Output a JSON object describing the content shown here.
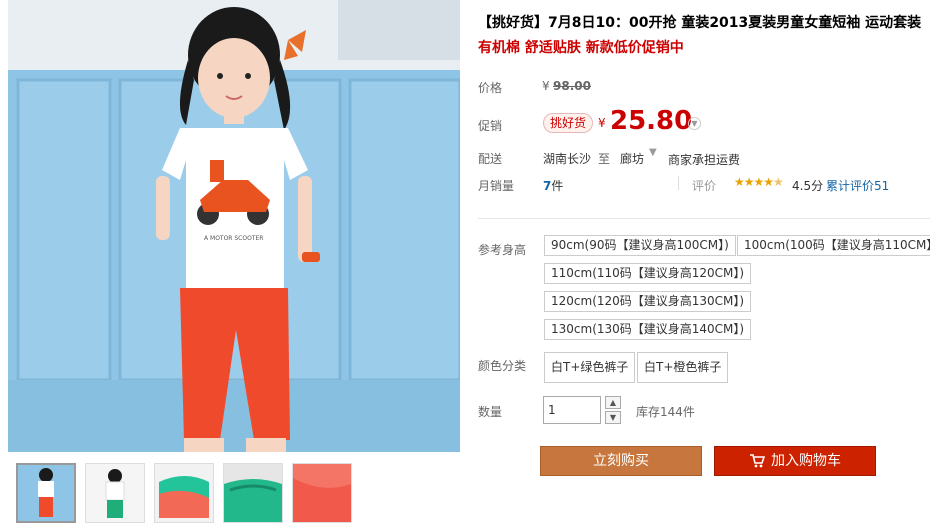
{
  "product": {
    "title": "【挑好货】7月8日10：00开抢 童装2013夏装男童女童短袖 运动套装",
    "subtitle": "有机棉 舒适贴肤 新款低价促销中"
  },
  "price": {
    "label": "价格",
    "currency": "¥",
    "original": "98.00"
  },
  "promo": {
    "label": "促销",
    "badge": "挑好货",
    "currency": "¥",
    "price": "25.80"
  },
  "shipping": {
    "label": "配送",
    "from": "湖南长沙",
    "to_label": "至",
    "to_city": "廊坊",
    "note": "商家承担运费"
  },
  "sales": {
    "label": "月销量",
    "count": "7",
    "unit": "件",
    "rating_label": "评价",
    "rating_score": "4.5分",
    "rating_count_text": "累计评价51",
    "rating_value": 4.5
  },
  "size": {
    "label": "参考身高",
    "options": [
      "90cm(90码【建议身高100CM】)",
      "100cm(100码【建议身高110CM】)",
      "110cm(110码【建议身高120CM】)",
      "120cm(120码【建议身高130CM】)",
      "130cm(130码【建议身高140CM】)"
    ]
  },
  "color": {
    "label": "颜色分类",
    "options": [
      "白T+绿色裤子",
      "白T+橙色裤子"
    ]
  },
  "quantity": {
    "label": "数量",
    "value": "1",
    "stock": "库存144件"
  },
  "actions": {
    "buy_now": "立刻购买",
    "add_to_cart": "加入购物车"
  },
  "colors": {
    "promo_red": "#cc0000",
    "buy_button": "#c7773d",
    "cart_button": "#cc2200",
    "link_blue": "#1565a6",
    "star": "#e8a300"
  }
}
